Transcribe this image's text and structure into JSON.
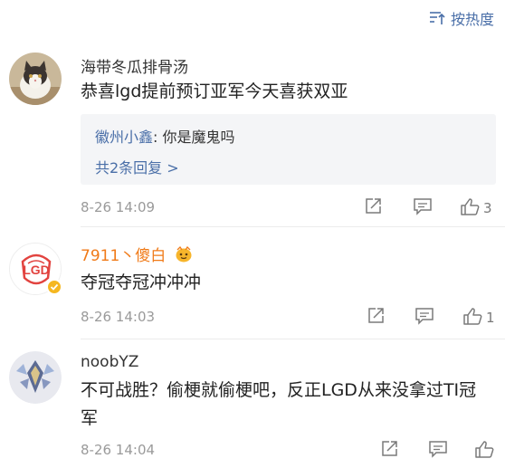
{
  "sort": {
    "label": "按热度"
  },
  "comments": [
    {
      "username": "海带冬瓜排骨汤",
      "text": "恭喜lgd提前预订亚军今天喜获双亚",
      "reply": {
        "user": "徽州小鑫",
        "text": ": 你是魔鬼吗",
        "more": "共2条回复 >"
      },
      "time": "8-26 14:09",
      "likes": "3"
    },
    {
      "username": "7911丶傻白",
      "text": "夺冠夺冠冲冲冲",
      "time": "8-26 14:03",
      "likes": "1"
    },
    {
      "username": "noobYZ",
      "text": "不可战胜？偷梗就偷梗吧，反正LGD从来没拿过TI冠军",
      "time": "8-26 14:04",
      "likes": ""
    }
  ]
}
